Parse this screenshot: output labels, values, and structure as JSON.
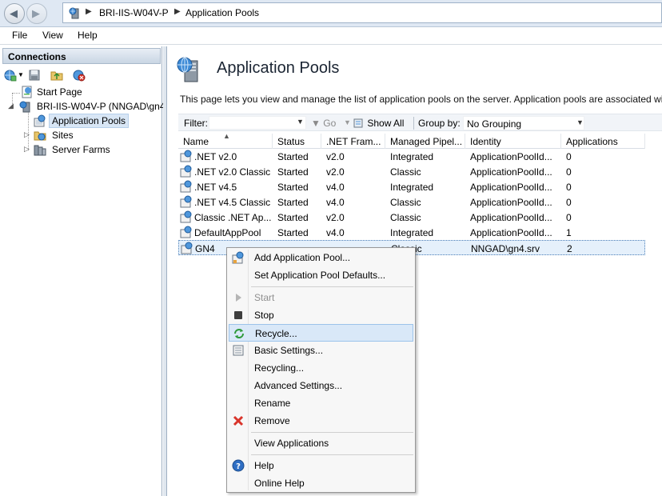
{
  "address_bar": {
    "crumbs": [
      "BRI-IIS-W04V-P",
      "Application Pools"
    ]
  },
  "menu": {
    "items": [
      "File",
      "View",
      "Help"
    ]
  },
  "connections": {
    "title": "Connections",
    "tree": {
      "start_page": "Start Page",
      "server": "BRI-IIS-W04V-P (NNGAD\\gn4",
      "application_pools": "Application Pools",
      "sites": "Sites",
      "server_farms": "Server Farms"
    }
  },
  "main": {
    "title": "Application Pools",
    "description": "This page lets you view and manage the list of application pools on the server. Application pools are associated wit",
    "filter": {
      "label": "Filter:",
      "value": "",
      "go_label": "Go",
      "show_all_label": "Show All",
      "group_by_label": "Group by:",
      "group_by_value": "No Grouping"
    },
    "columns": [
      "Name",
      "Status",
      ".NET Fram...",
      "Managed Pipel...",
      "Identity",
      "Applications"
    ],
    "rows": [
      {
        "name": ".NET v2.0",
        "status": "Started",
        "net": "v2.0",
        "pipeline": "Integrated",
        "identity": "ApplicationPoolId...",
        "apps": "0"
      },
      {
        "name": ".NET v2.0 Classic",
        "status": "Started",
        "net": "v2.0",
        "pipeline": "Classic",
        "identity": "ApplicationPoolId...",
        "apps": "0"
      },
      {
        "name": ".NET v4.5",
        "status": "Started",
        "net": "v4.0",
        "pipeline": "Integrated",
        "identity": "ApplicationPoolId...",
        "apps": "0"
      },
      {
        "name": ".NET v4.5 Classic",
        "status": "Started",
        "net": "v4.0",
        "pipeline": "Classic",
        "identity": "ApplicationPoolId...",
        "apps": "0"
      },
      {
        "name": "Classic .NET Ap...",
        "status": "Started",
        "net": "v2.0",
        "pipeline": "Classic",
        "identity": "ApplicationPoolId...",
        "apps": "0"
      },
      {
        "name": "DefaultAppPool",
        "status": "Started",
        "net": "v4.0",
        "pipeline": "Integrated",
        "identity": "ApplicationPoolId...",
        "apps": "1"
      },
      {
        "name": "GN4",
        "status": "",
        "net": "",
        "pipeline": "Classic",
        "identity": "NNGAD\\gn4.srv",
        "apps": "2"
      }
    ]
  },
  "context_menu": {
    "add_pool": "Add Application Pool...",
    "set_defaults": "Set Application Pool Defaults...",
    "start": "Start",
    "stop": "Stop",
    "recycle": "Recycle...",
    "basic_settings": "Basic Settings...",
    "recycling": "Recycling...",
    "advanced_settings": "Advanced Settings...",
    "rename": "Rename",
    "remove": "Remove",
    "view_applications": "View Applications",
    "help": "Help",
    "online_help": "Online Help"
  },
  "colors": {
    "selection": "#e5f0fb",
    "hot_item": "#d9e8f8",
    "chrome": "#dfe8f3"
  }
}
